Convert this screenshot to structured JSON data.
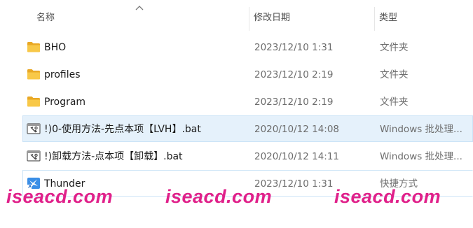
{
  "columns": {
    "name": "名称",
    "modified": "修改日期",
    "type": "类型",
    "sort_indicator": "chevron-up-icon"
  },
  "files": [
    {
      "name": "BHO",
      "modified": "2023/12/10 1:31",
      "type": "文件夹",
      "icon": "folder-icon",
      "selected": false
    },
    {
      "name": "profiles",
      "modified": "2023/12/10 2:19",
      "type": "文件夹",
      "icon": "folder-icon",
      "selected": false
    },
    {
      "name": "Program",
      "modified": "2023/12/10 2:19",
      "type": "文件夹",
      "icon": "folder-icon",
      "selected": false
    },
    {
      "name": "!)0-使用方法-先点本项【LVH】.bat",
      "modified": "2020/10/12 14:08",
      "type": "Windows 批处理...",
      "icon": "batch-file-icon",
      "selected": true
    },
    {
      "name": "!)卸载方法-点本项【卸载】.bat",
      "modified": "2020/10/12 14:11",
      "type": "Windows 批处理...",
      "icon": "batch-file-icon",
      "selected": false
    },
    {
      "name": "Thunder",
      "modified": "2023/12/10 1:31",
      "type": "快捷方式",
      "icon": "shortcut-icon",
      "selected": false
    }
  ],
  "watermark": [
    "iseacd.com",
    "iseacd.com",
    "iseacd.com"
  ],
  "colors": {
    "selection_background": "#e5f1fb",
    "selection_border": "#cce4f7",
    "folder_yellow": "#f8c848",
    "watermark": "#e0218a",
    "secondary_text": "#6d6d6d"
  }
}
